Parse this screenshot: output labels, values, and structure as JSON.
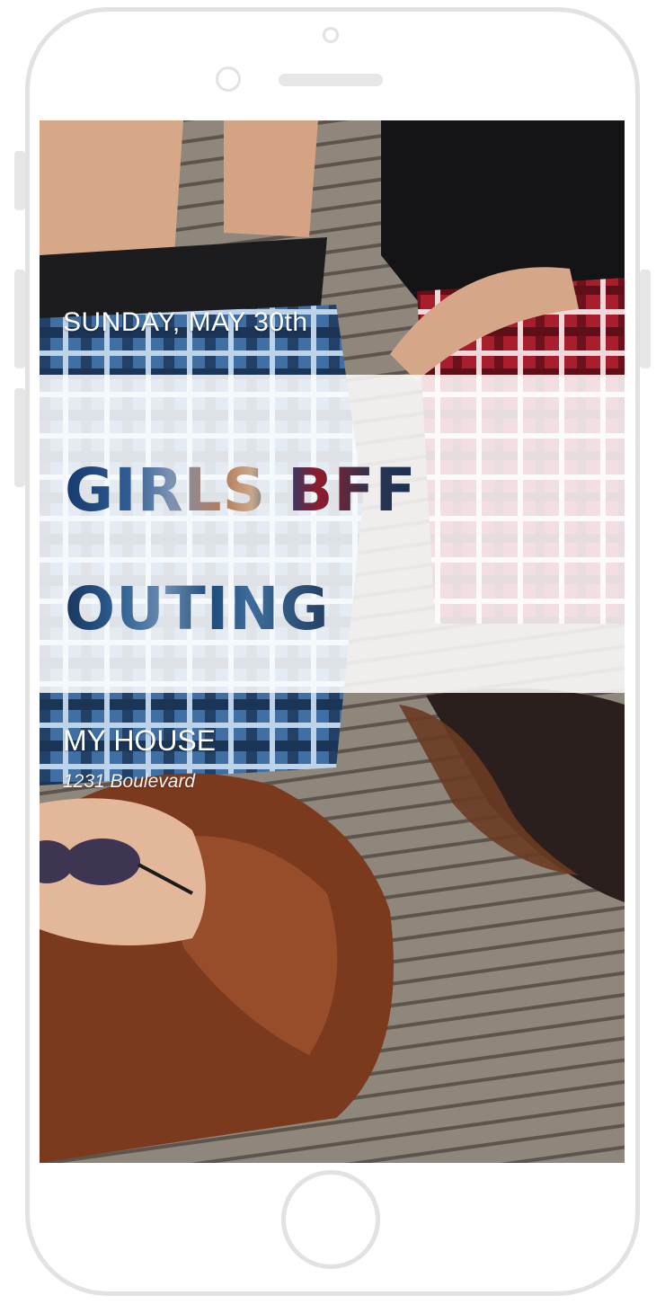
{
  "invite": {
    "date": "SUNDAY, MAY 30th",
    "title_line1": "GIRLS BFF",
    "title_line2": "OUTING",
    "venue": "MY HOUSE",
    "address": "1231 Boulevard"
  },
  "colors": {
    "background": "#ffffff",
    "phone_frame": "#e2e2e2",
    "band": "#ffffff",
    "title_navy": "#1f3f73",
    "title_red": "#8e1c2d",
    "text_on_photo": "#ffffff"
  },
  "icons": {
    "front_camera": "front-camera-icon",
    "speaker": "speaker-icon",
    "home_button": "home-button-icon"
  }
}
